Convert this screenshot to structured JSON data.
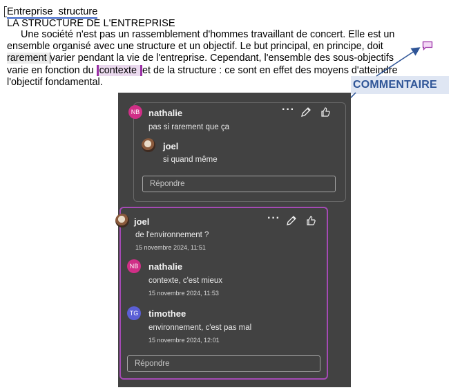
{
  "document": {
    "title": "Entreprise  structure",
    "subtitle": "LA STRUCTURE DE L'ENTREPRISE",
    "para_start": "Une société n'est pas un rassemblement d'hommes travaillant de concert. Elle est un ensemble organisé avec une structure et un objectif. Le but principal, en principe, doit ",
    "para_highlight1": "rarement ",
    "para_mid": "varier pendant la vie de l'entreprise. Cependant, l'ensemble des sous-objectifs varie en fonction du ",
    "para_highlight2": "contexte ",
    "para_end": "et de la structure : ce sont en effet des moyens d'atteindre l'objectif fondamental."
  },
  "annotation": {
    "label": "COMMENTAIRE",
    "color": "#2f5597"
  },
  "comments": {
    "thread1": {
      "author": "nathalie",
      "initials": "NB",
      "text": "pas si rarement que ça",
      "reply": {
        "author": "joel",
        "text": "si quand même"
      },
      "reply_placeholder": "Répondre"
    },
    "thread2": {
      "author": "joel",
      "text": "de l'environnement ?",
      "time": "15 novembre 2024, 11:51",
      "replies": [
        {
          "author": "nathalie",
          "initials": "NB",
          "text": "contexte, c'est mieux",
          "time": "15 novembre 2024, 11:53"
        },
        {
          "author": "timothee",
          "initials": "TG",
          "text": "environnement, c'est pas mal",
          "time": "15 novembre 2024, 12:01"
        }
      ],
      "reply_placeholder": "Répondre"
    }
  },
  "icons": {
    "more": "more-options-icon",
    "edit": "pencil-icon",
    "like": "thumbs-up-icon",
    "comment": "comment-bubble-icon"
  },
  "colors": {
    "pane_bg": "#424242",
    "active_border": "#a54ab5",
    "nb_avatar": "#d02f87",
    "tg_avatar": "#5b5fd6"
  }
}
